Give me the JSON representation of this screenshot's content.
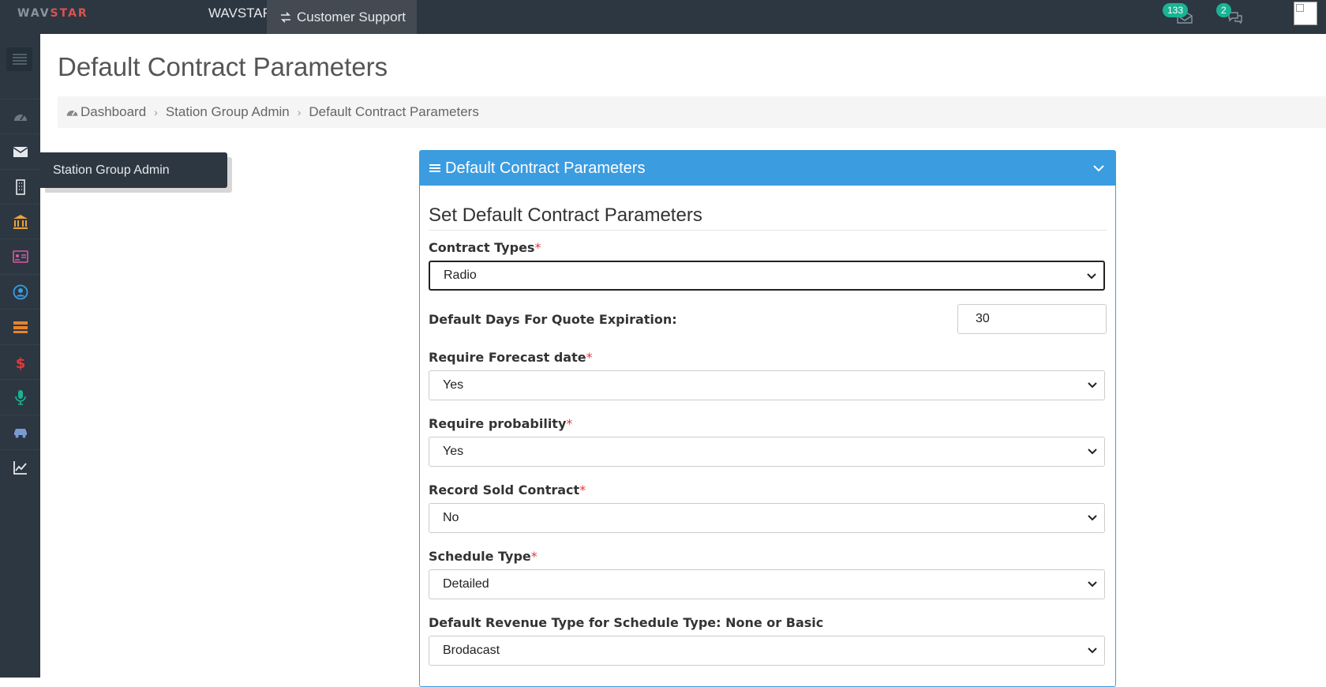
{
  "topbar": {
    "logo_main": "WAV",
    "logo_accent": "STAR",
    "app_name": "WAVSTAR",
    "support_label": "Customer Support",
    "mail_count": "133",
    "chat_count": "2"
  },
  "sidebar": {
    "tooltip": "Station Group Admin",
    "icons": [
      "dashboard-icon",
      "envelope-icon",
      "building-icon",
      "bank-icon",
      "id-card-icon",
      "user-circle-icon",
      "server-icon",
      "dollar-icon",
      "microphone-icon",
      "car-icon",
      "line-chart-icon"
    ]
  },
  "page": {
    "title": "Default Contract Parameters"
  },
  "breadcrumb": {
    "items": [
      "Dashboard",
      "Station Group Admin",
      "Default Contract Parameters"
    ]
  },
  "panel": {
    "header": "Default Contract Parameters",
    "section_title": "Set Default Contract Parameters",
    "contract_types": {
      "label": "Contract Types",
      "required": "*",
      "value": "Radio"
    },
    "quote_expiration": {
      "label": "Default Days For Quote Expiration:",
      "value": "30"
    },
    "forecast_date": {
      "label": "Require Forecast date",
      "required": "*",
      "value": "Yes"
    },
    "probability": {
      "label": "Require probability",
      "required": "*",
      "value": "Yes"
    },
    "record_sold": {
      "label": "Record Sold Contract",
      "required": "*",
      "value": "No"
    },
    "schedule_type": {
      "label": "Schedule Type",
      "required": "*",
      "value": "Detailed"
    },
    "revenue_type": {
      "label": "Default Revenue Type for Schedule Type: None or Basic",
      "value": "Brodacast"
    }
  },
  "colors": {
    "topbar_bg": "#2d3742",
    "accent_blue": "#3b9ce0",
    "badge_green": "#1ab394",
    "required_red": "#e03a3a"
  }
}
